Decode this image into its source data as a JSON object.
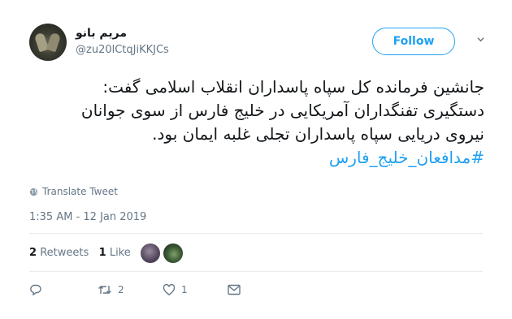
{
  "author": {
    "display_name": "مریم بانو",
    "handle": "@zu20lCtqJiKKJCs"
  },
  "follow_label": "Follow",
  "tweet": {
    "lines": [
      "جانشین فرمانده کل سپاه پاسداران انقلاب اسلامی گفت:",
      "دستگیری تفنگداران آمریکایی در خلیج فارس از سوی جوانان",
      "نیروی دریایی سپاه پاسداران تجلی غلبه ایمان بود."
    ],
    "hashtag": "#مدافعان_خلیج_فارس"
  },
  "translate_label": "Translate Tweet",
  "timestamp": "1:35 AM - 12 Jan 2019",
  "stats": {
    "retweets_count": "2",
    "retweets_label": "Retweets",
    "likes_count": "1",
    "likes_label": "Like"
  },
  "actions": {
    "reply_count": "",
    "retweet_count": "2",
    "like_count": "1"
  },
  "colors": {
    "accent": "#1da1f2",
    "muted": "#657786",
    "text": "#14171a",
    "divider": "#e6ecf0"
  },
  "icons": [
    "globe-icon",
    "chevron-down-icon",
    "reply-icon",
    "retweet-icon",
    "heart-icon",
    "mail-icon"
  ]
}
